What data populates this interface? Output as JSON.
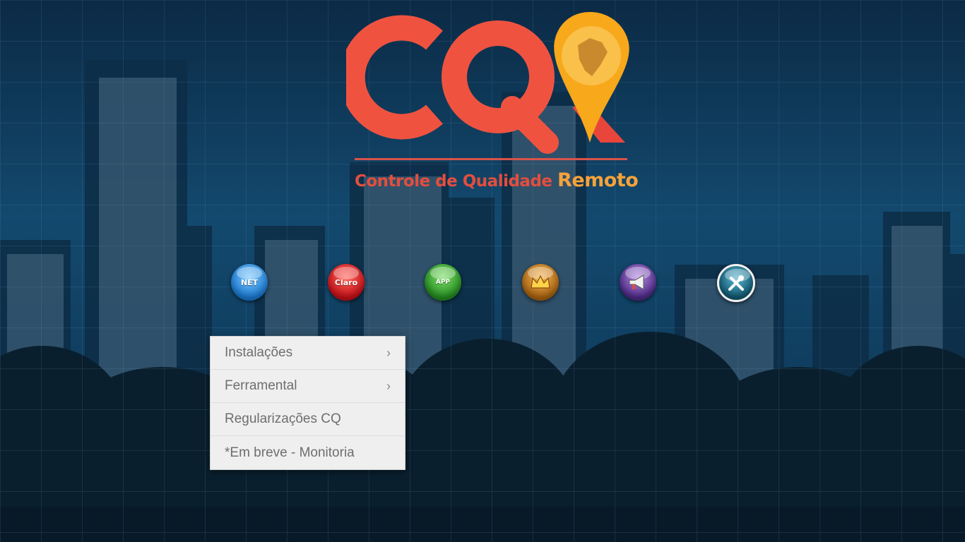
{
  "logo": {
    "mark": "CQR",
    "tagline_main": "Controle de Qualidade",
    "tagline_accent": "Remoto",
    "colors": {
      "red": "#ef5340",
      "orange": "#f7a81b",
      "map": "#c98a2e"
    }
  },
  "icons": [
    {
      "name": "net-icon",
      "label": "NET",
      "color": "#2a8fe0"
    },
    {
      "name": "claro-icon",
      "label": "Claro",
      "color": "#d7161a"
    },
    {
      "name": "android-app-icon",
      "label": "APP",
      "color": "#2e9d2a"
    },
    {
      "name": "crown-icon",
      "label": "",
      "color": "#c77d1a"
    },
    {
      "name": "megaphone-icon",
      "label": "",
      "color": "#6a3d9a"
    },
    {
      "name": "tools-icon",
      "label": "",
      "color": "#1f6f8a"
    }
  ],
  "menu": {
    "items": [
      {
        "label": "Instalações",
        "has_submenu": true,
        "arrow": "›"
      },
      {
        "label": "Ferramental",
        "has_submenu": true,
        "arrow": "›"
      },
      {
        "label": "Regularizações CQ",
        "has_submenu": false,
        "arrow": ""
      },
      {
        "label": "*Em breve - Monitoria",
        "has_submenu": false,
        "arrow": ""
      }
    ]
  }
}
